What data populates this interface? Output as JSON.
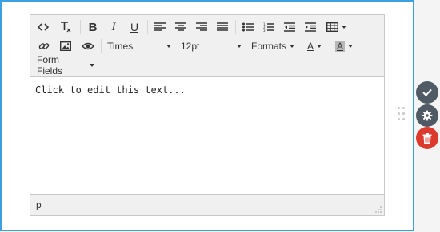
{
  "colors": {
    "frame": "#3aa0e0",
    "confirm": "#4f5a64",
    "settings": "#4f5a64",
    "delete": "#dd3a2e"
  },
  "toolbar": {
    "font_family": "Times",
    "font_size": "12pt",
    "formats_label": "Formats",
    "form_fields_label": "Form Fields",
    "text_color_letter": "A",
    "bg_color_letter": "A",
    "bold_letter": "B",
    "italic_letter": "I",
    "underline_letter": "U"
  },
  "content": {
    "text": "Click to edit this text..."
  },
  "status": {
    "path": "p"
  },
  "side_actions": [
    "check-icon",
    "gear-icon",
    "trash-icon"
  ]
}
